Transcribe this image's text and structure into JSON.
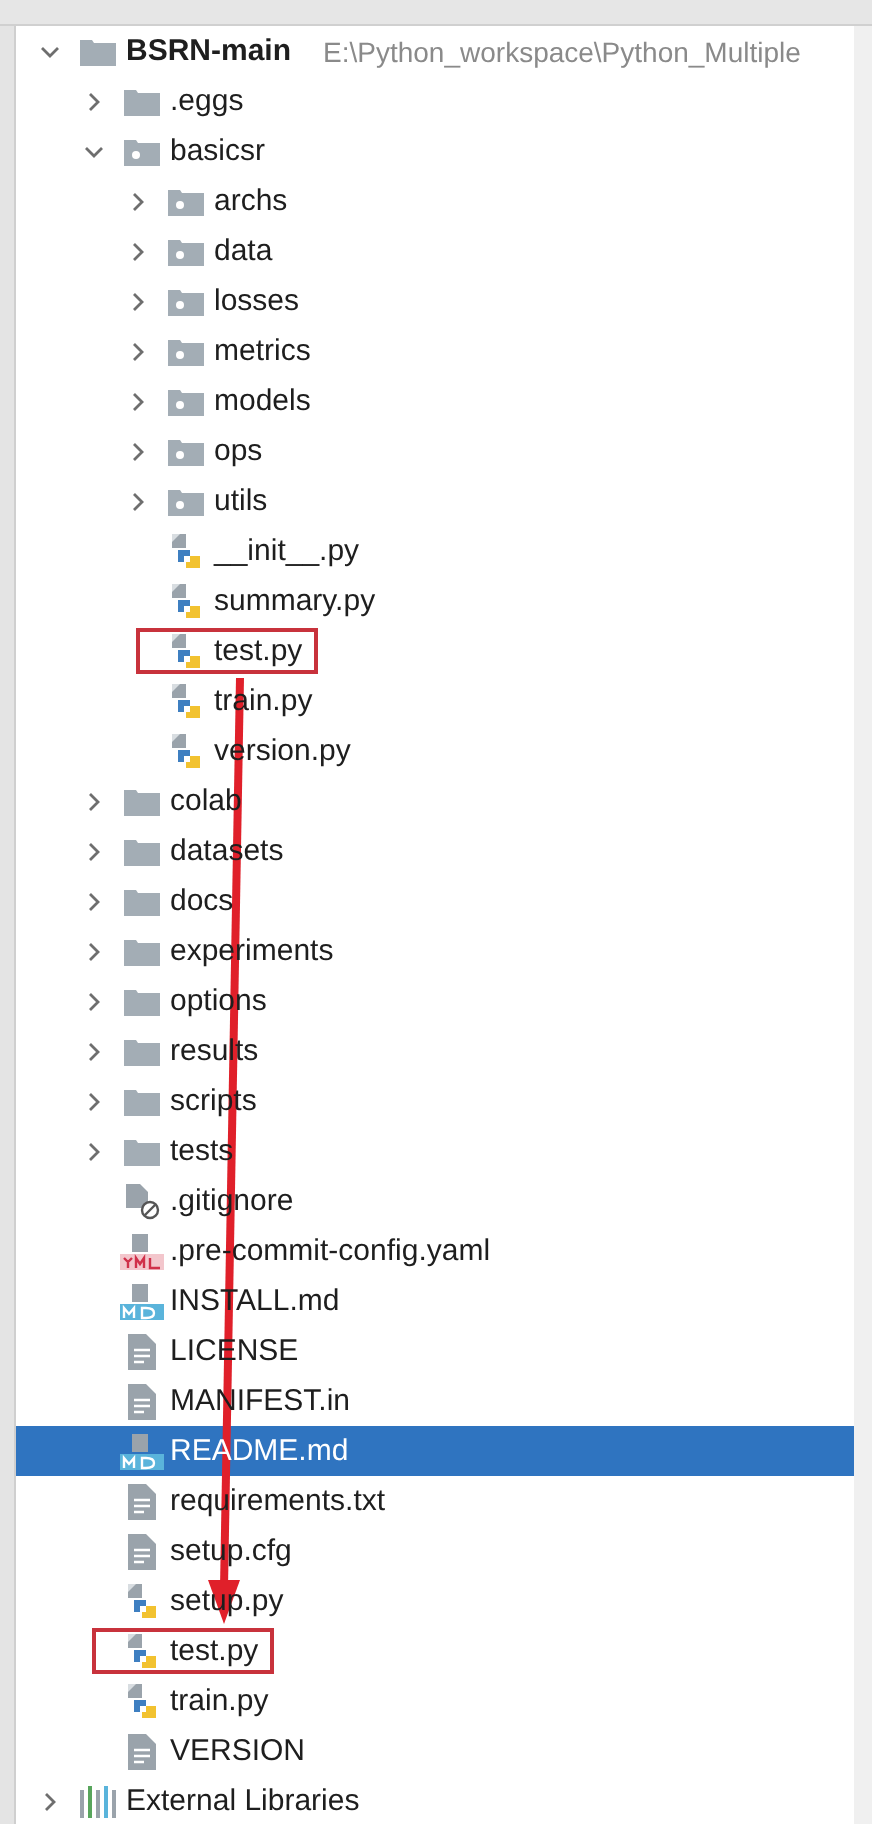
{
  "tree": [
    {
      "name": "BSRN-main",
      "path": "E:\\Python_workspace\\Python_Multiple",
      "kind": "folder",
      "expanded": true,
      "selected": false,
      "highlighted": false,
      "children": [
        {
          "name": ".eggs",
          "kind": "folder",
          "expanded": false,
          "selected": false,
          "highlighted": false
        },
        {
          "name": "basicsr",
          "kind": "module",
          "expanded": true,
          "selected": false,
          "highlighted": false,
          "children": [
            {
              "name": "archs",
              "kind": "module",
              "expanded": false,
              "selected": false,
              "highlighted": false
            },
            {
              "name": "data",
              "kind": "module",
              "expanded": false,
              "selected": false,
              "highlighted": false
            },
            {
              "name": "losses",
              "kind": "module",
              "expanded": false,
              "selected": false,
              "highlighted": false
            },
            {
              "name": "metrics",
              "kind": "module",
              "expanded": false,
              "selected": false,
              "highlighted": false
            },
            {
              "name": "models",
              "kind": "module",
              "expanded": false,
              "selected": false,
              "highlighted": false
            },
            {
              "name": "ops",
              "kind": "module",
              "expanded": false,
              "selected": false,
              "highlighted": false
            },
            {
              "name": "utils",
              "kind": "module",
              "expanded": false,
              "selected": false,
              "highlighted": false
            },
            {
              "name": "__init__.py",
              "kind": "python",
              "selected": false,
              "highlighted": false
            },
            {
              "name": "summary.py",
              "kind": "python",
              "selected": false,
              "highlighted": false
            },
            {
              "name": "test.py",
              "kind": "python",
              "selected": false,
              "highlighted": true
            },
            {
              "name": "train.py",
              "kind": "python",
              "selected": false,
              "highlighted": false
            },
            {
              "name": "version.py",
              "kind": "python",
              "selected": false,
              "highlighted": false
            }
          ]
        },
        {
          "name": "colab",
          "kind": "folder",
          "expanded": false,
          "selected": false,
          "highlighted": false
        },
        {
          "name": "datasets",
          "kind": "folder",
          "expanded": false,
          "selected": false,
          "highlighted": false
        },
        {
          "name": "docs",
          "kind": "folder",
          "expanded": false,
          "selected": false,
          "highlighted": false
        },
        {
          "name": "experiments",
          "kind": "folder",
          "expanded": false,
          "selected": false,
          "highlighted": false
        },
        {
          "name": "options",
          "kind": "folder",
          "expanded": false,
          "selected": false,
          "highlighted": false
        },
        {
          "name": "results",
          "kind": "folder",
          "expanded": false,
          "selected": false,
          "highlighted": false
        },
        {
          "name": "scripts",
          "kind": "folder",
          "expanded": false,
          "selected": false,
          "highlighted": false
        },
        {
          "name": "tests",
          "kind": "folder",
          "expanded": false,
          "selected": false,
          "highlighted": false
        },
        {
          "name": ".gitignore",
          "kind": "ignore",
          "selected": false,
          "highlighted": false
        },
        {
          "name": ".pre-commit-config.yaml",
          "kind": "yaml",
          "selected": false,
          "highlighted": false
        },
        {
          "name": "INSTALL.md",
          "kind": "markdown",
          "selected": false,
          "highlighted": false
        },
        {
          "name": "LICENSE",
          "kind": "text",
          "selected": false,
          "highlighted": false
        },
        {
          "name": "MANIFEST.in",
          "kind": "text",
          "selected": false,
          "highlighted": false
        },
        {
          "name": "README.md",
          "kind": "markdown",
          "selected": true,
          "highlighted": false
        },
        {
          "name": "requirements.txt",
          "kind": "text",
          "selected": false,
          "highlighted": false
        },
        {
          "name": "setup.cfg",
          "kind": "text",
          "selected": false,
          "highlighted": false
        },
        {
          "name": "setup.py",
          "kind": "python",
          "selected": false,
          "highlighted": false
        },
        {
          "name": "test.py",
          "kind": "python",
          "selected": false,
          "highlighted": true
        },
        {
          "name": "train.py",
          "kind": "python",
          "selected": false,
          "highlighted": false
        },
        {
          "name": "VERSION",
          "kind": "text",
          "selected": false,
          "highlighted": false
        }
      ]
    },
    {
      "name": "External Libraries",
      "kind": "libraries",
      "expanded": false,
      "selected": false,
      "highlighted": false
    }
  ],
  "annotations": [
    {
      "kind": "arrow"
    }
  ]
}
